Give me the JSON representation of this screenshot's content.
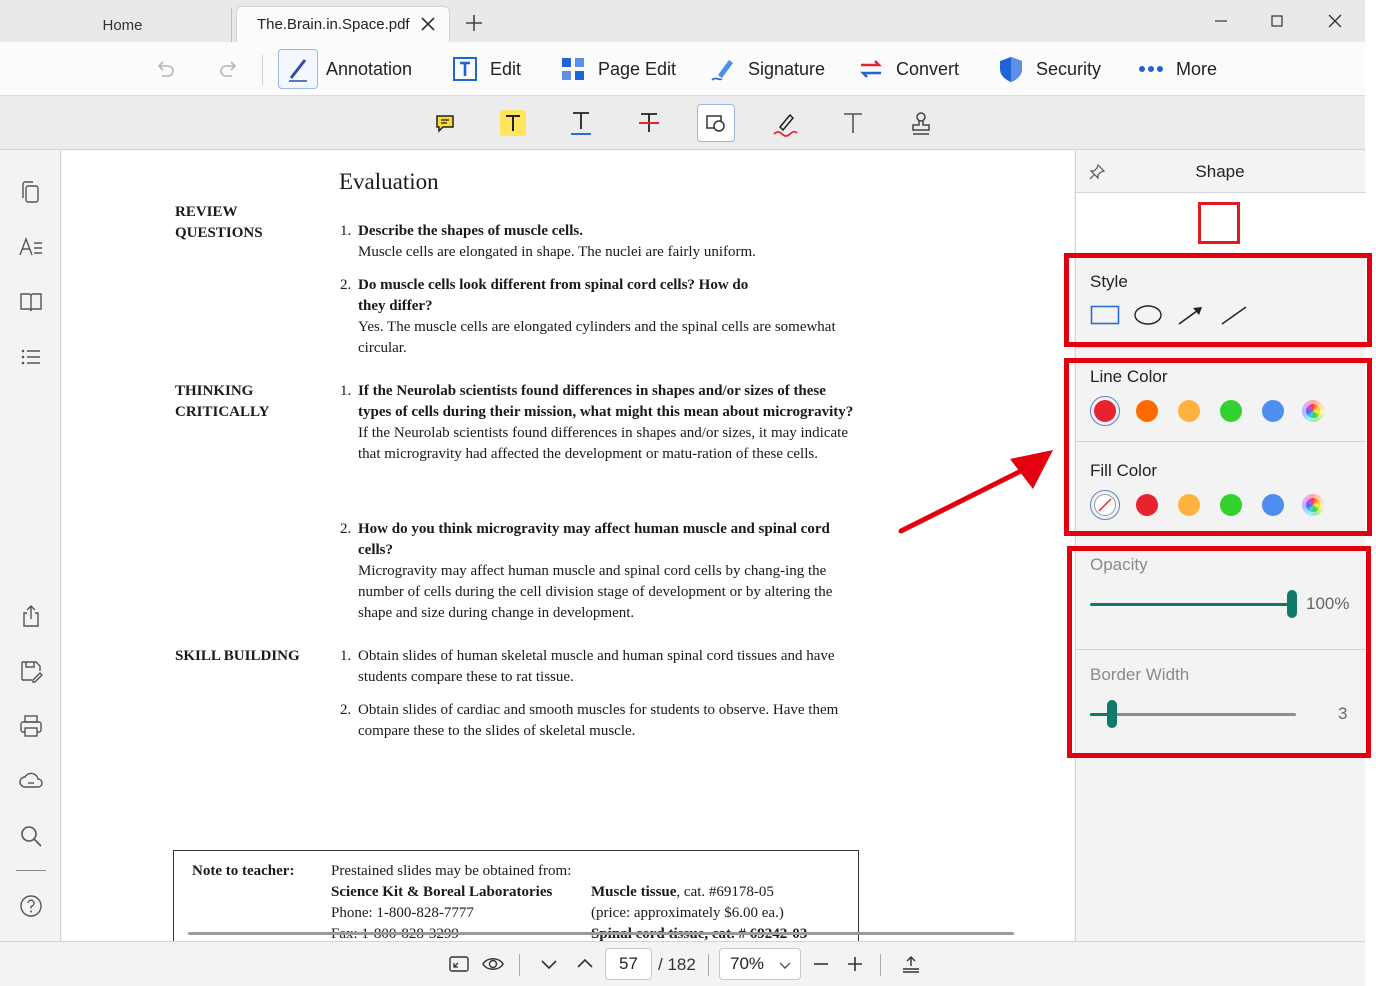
{
  "tabs": {
    "home": "Home",
    "active": "The.Brain.in.Space.pdf"
  },
  "toolbar": {
    "annotation": "Annotation",
    "edit": "Edit",
    "page_edit": "Page Edit",
    "signature": "Signature",
    "convert": "Convert",
    "security": "Security",
    "more": "More"
  },
  "document": {
    "title": "Evaluation",
    "sections": {
      "review": "REVIEW\nQUESTIONS",
      "thinking": "THINKING\nCRITICALLY",
      "skill": "SKILL BUILDING"
    },
    "review_q1": {
      "num": "1.",
      "question": "Describe the shapes of muscle cells.",
      "answer": "Muscle cells are elongated in shape. The nuclei are fairly uniform."
    },
    "review_q2": {
      "num": "2.",
      "question": "Do muscle cells look different from spinal cord cells? How do they differ?",
      "answer": "Yes. The muscle cells are elongated cylinders and the spinal cells are somewhat circular."
    },
    "thinking_q1": {
      "num": "1.",
      "question": "If the Neurolab scientists found differences in shapes and/or sizes of these types of cells during their mission, what might this mean about microgravity?",
      "answer": "If the Neurolab scientists found differences in shapes and/or sizes, it may indicate that microgravity had affected the development or matu-ration of these cells."
    },
    "thinking_q2": {
      "num": "2.",
      "question": "How do you think microgravity may affect human muscle and spinal cord cells?",
      "answer": "Microgravity may affect human muscle and spinal cord cells by chang-ing the number of cells during the cell division stage of development or by altering the shape and size during change in development."
    },
    "skill_1": {
      "num": "1.",
      "text": "Obtain slides of human skeletal muscle and human spinal cord tissues and have students compare these to rat tissue."
    },
    "skill_2": {
      "num": "2.",
      "text": "Obtain slides of cardiac and smooth muscles for students to observe. Have them compare these to the slides of skeletal muscle."
    },
    "note": {
      "label": "Note to teacher:",
      "intro": "Prestained slides may be obtained from:",
      "supplier": "Science Kit & Boreal Laboratories",
      "phone": "Phone: 1-800-828-7777",
      "fax": "Fax: 1-800-828-3299",
      "item1_name": "Muscle tissue",
      "item1_cat": ", cat. #69178-05",
      "item1_price": "(price: approximately $6.00 ea.)",
      "item2": "Spinal cord tissue, cat. # 69242-03"
    }
  },
  "panel": {
    "title": "Shape",
    "style_label": "Style",
    "line_color_label": "Line Color",
    "fill_color_label": "Fill Color",
    "opacity_label": "Opacity",
    "opacity_value": "100%",
    "opacity_fraction": 1.0,
    "border_width_label": "Border Width",
    "border_width_value": "3",
    "line_colors": [
      "#e8222e",
      "#ff6a00",
      "#ffb23f",
      "#33d12f",
      "#4d8ef0",
      "rainbow"
    ],
    "fill_colors": [
      "none",
      "#e8222e",
      "#ffb23f",
      "#33d12f",
      "#4d8ef0",
      "rainbow"
    ],
    "selected_line_color": "#e8222e",
    "slider_color": "#0f7a69"
  },
  "status": {
    "page_current": "57",
    "page_total": "/ 182",
    "zoom": "70%"
  },
  "highlight_color": "#e3000f"
}
